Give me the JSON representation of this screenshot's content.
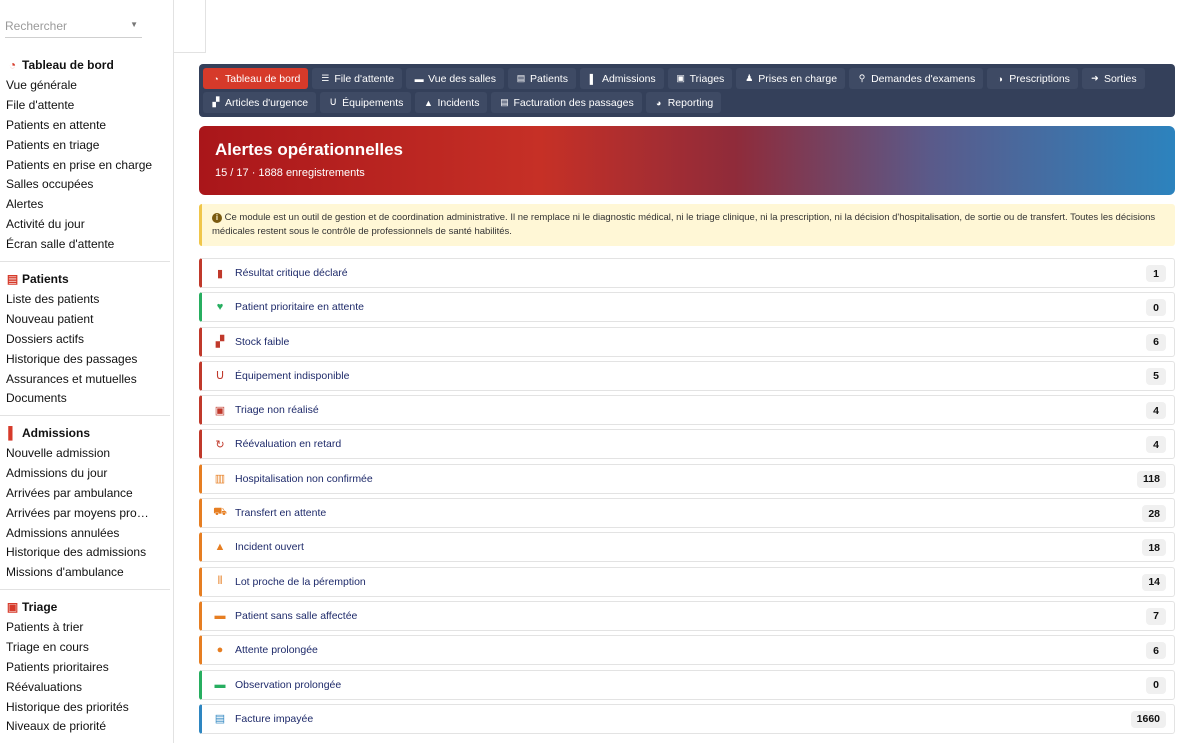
{
  "search": {
    "placeholder": "Rechercher"
  },
  "sidebar": {
    "sections": [
      {
        "title": "Tableau de bord",
        "icon": "gauge-icon",
        "items": [
          "Vue générale",
          "File d'attente",
          "Patients en attente",
          "Patients en triage",
          "Patients en prise en charge",
          "Salles occupées",
          "Alertes",
          "Activité du jour",
          "Écran salle d'attente"
        ]
      },
      {
        "title": "Patients",
        "icon": "id-card-icon",
        "items": [
          "Liste des patients",
          "Nouveau patient",
          "Dossiers actifs",
          "Historique des passages",
          "Assurances et mutuelles",
          "Documents"
        ]
      },
      {
        "title": "Admissions",
        "icon": "door-icon",
        "items": [
          "Nouvelle admission",
          "Admissions du jour",
          "Arrivées par ambulance",
          "Arrivées par moyens pro…",
          "Admissions annulées",
          "Historique des admissions",
          "Missions d'ambulance"
        ]
      },
      {
        "title": "Triage",
        "icon": "clipboard-icon",
        "items": [
          "Patients à trier",
          "Triage en cours",
          "Patients prioritaires",
          "Réévaluations",
          "Historique des priorités",
          "Niveaux de priorité"
        ]
      }
    ]
  },
  "nav": {
    "row1": [
      {
        "label": "Tableau de bord",
        "icon": "gauge-icon",
        "active": true
      },
      {
        "label": "File d'attente",
        "icon": "list-icon"
      },
      {
        "label": "Vue des salles",
        "icon": "bed-icon"
      },
      {
        "label": "Patients",
        "icon": "id-card-icon"
      },
      {
        "label": "Admissions",
        "icon": "door-icon"
      },
      {
        "label": "Triages",
        "icon": "clipboard-icon"
      },
      {
        "label": "Prises en charge",
        "icon": "user-doctor-icon"
      },
      {
        "label": "Demandes d'examens",
        "icon": "microscope-icon"
      },
      {
        "label": "Prescriptions",
        "icon": "pills-icon"
      },
      {
        "label": "Sorties",
        "icon": "exit-icon"
      }
    ],
    "row2": [
      {
        "label": "Articles d'urgence",
        "icon": "boxes-icon"
      },
      {
        "label": "Équipements",
        "icon": "stethoscope-icon"
      },
      {
        "label": "Incidents",
        "icon": "warning-icon"
      },
      {
        "label": "Facturation des passages",
        "icon": "invoice-icon"
      },
      {
        "label": "Reporting",
        "icon": "pie-chart-icon"
      }
    ]
  },
  "hero": {
    "title": "Alertes opérationnelles",
    "subtitle": "15 / 17 · 1888 enregistrements"
  },
  "notice": {
    "text": "Ce module est un outil de gestion et de coordination administrative. Il ne remplace ni le diagnostic médical, ni le triage clinique, ni la prescription, ni la décision d'hospitalisation, de sortie ou de transfert. Toutes les décisions médicales restent sous le contrôle de professionnels de santé habilités."
  },
  "alerts": [
    {
      "label": "Résultat critique déclaré",
      "count": "1",
      "color": "#c0392b",
      "icon": "file-medical-icon",
      "glyph": "▮"
    },
    {
      "label": "Patient prioritaire en attente",
      "count": "0",
      "color": "#27ae60",
      "icon": "heart-pulse-icon",
      "glyph": "♥"
    },
    {
      "label": "Stock faible",
      "count": "6",
      "color": "#c0392b",
      "icon": "boxes-icon",
      "glyph": "▞"
    },
    {
      "label": "Équipement indisponible",
      "count": "5",
      "color": "#c0392b",
      "icon": "stethoscope-icon",
      "glyph": "ᑌ"
    },
    {
      "label": "Triage non réalisé",
      "count": "4",
      "color": "#c0392b",
      "icon": "clipboard-check-icon",
      "glyph": "▣"
    },
    {
      "label": "Réévaluation en retard",
      "count": "4",
      "color": "#c0392b",
      "icon": "rotate-icon",
      "glyph": "↻"
    },
    {
      "label": "Hospitalisation non confirmée",
      "count": "118",
      "color": "#e67e22",
      "icon": "hospital-icon",
      "glyph": "▥"
    },
    {
      "label": "Transfert en attente",
      "count": "28",
      "color": "#e67e22",
      "icon": "truck-icon",
      "glyph": "⛟"
    },
    {
      "label": "Incident ouvert",
      "count": "18",
      "color": "#e67e22",
      "icon": "warning-icon",
      "glyph": "▲"
    },
    {
      "label": "Lot proche de la péremption",
      "count": "14",
      "color": "#e67e22",
      "icon": "barcode-icon",
      "glyph": "⦀"
    },
    {
      "label": "Patient sans salle affectée",
      "count": "7",
      "color": "#e67e22",
      "icon": "bed-icon",
      "glyph": "▬"
    },
    {
      "label": "Attente prolongée",
      "count": "6",
      "color": "#e67e22",
      "icon": "clock-icon",
      "glyph": "●"
    },
    {
      "label": "Observation prolongée",
      "count": "0",
      "color": "#27ae60",
      "icon": "bed-icon",
      "glyph": "▬"
    },
    {
      "label": "Facture impayée",
      "count": "1660",
      "color": "#2e86c1",
      "icon": "invoice-icon",
      "glyph": "▤"
    }
  ]
}
